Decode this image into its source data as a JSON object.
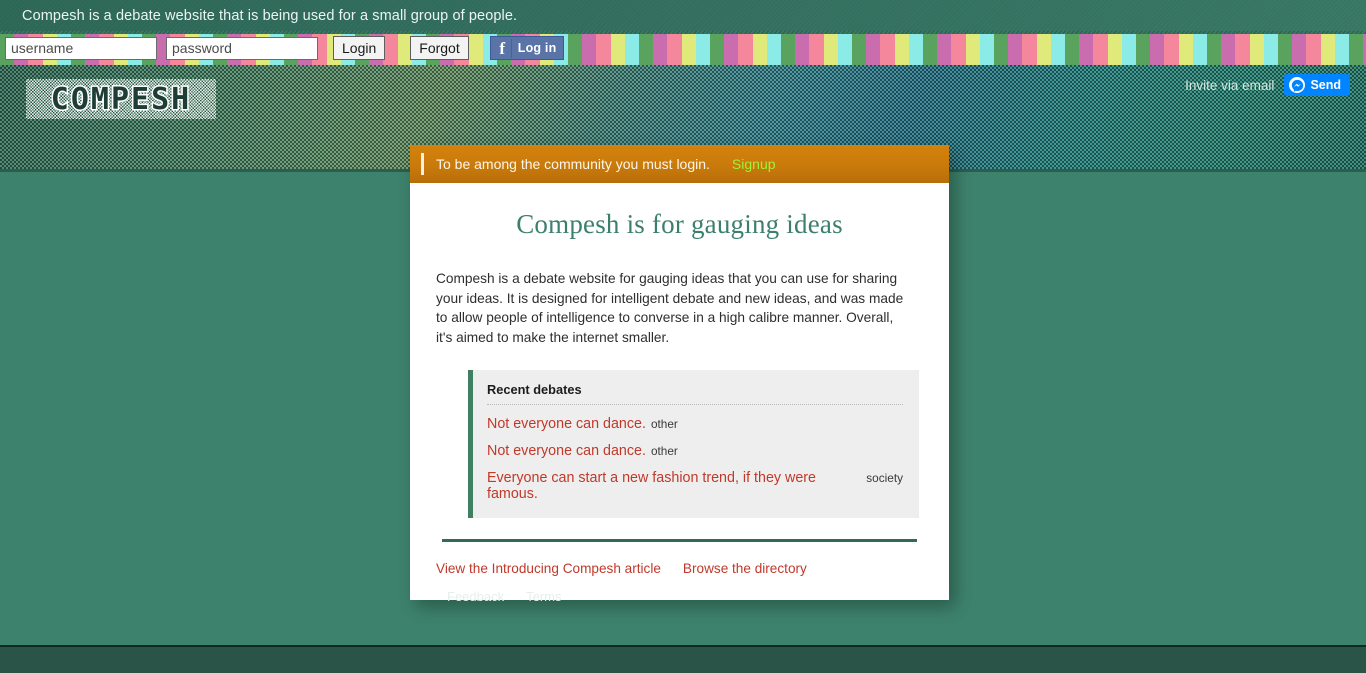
{
  "site": {
    "name": "COMPESH",
    "tagline": "Compesh is a debate website that is being used for a small group of people."
  },
  "login_strip": {
    "username_placeholder": "username",
    "username_value": "",
    "password_placeholder": "password",
    "password_value": "",
    "login_label": "Login",
    "forgot_label": "Forgot",
    "facebook_label": "Log in",
    "facebook_icon": "facebook-f-icon"
  },
  "header": {
    "invite_label": "Invite via email",
    "messenger_send_label": "Send",
    "messenger_icon": "messenger-icon"
  },
  "notice": {
    "text": "To be among the community you must login.",
    "signup_label": "Signup"
  },
  "main": {
    "heading": "Compesh is for gauging ideas",
    "intro": "Compesh is a debate website for gauging ideas that you can use for sharing your ideas. It is designed for intelligent debate and new ideas, and was made to allow people of intelligence to converse in a high calibre manner. Overall, it's aimed to make the internet smaller.",
    "recent_debates_title": "Recent debates",
    "recent_debates": [
      {
        "title": "Not everyone can dance.",
        "category": "other"
      },
      {
        "title": "Not everyone can dance.",
        "category": "other"
      },
      {
        "title": "Everyone can start a new fashion trend, if they were famous.",
        "category": "society"
      }
    ],
    "links": [
      {
        "label": "View the Introducing Compesh article"
      },
      {
        "label": "Browse the directory"
      }
    ]
  },
  "footer": {
    "links": [
      {
        "label": "Feedback"
      },
      {
        "label": "Terms"
      }
    ]
  },
  "colors": {
    "page_background": "#3d826c",
    "heading_teal": "#3c7f6d",
    "link_red": "#c0392b",
    "notice_orange": "#c97a0b",
    "signup_green": "#9ef237",
    "facebook_blue": "#5b74a8",
    "messenger_blue": "#0084ff",
    "footer_bar": "#2a5447"
  }
}
